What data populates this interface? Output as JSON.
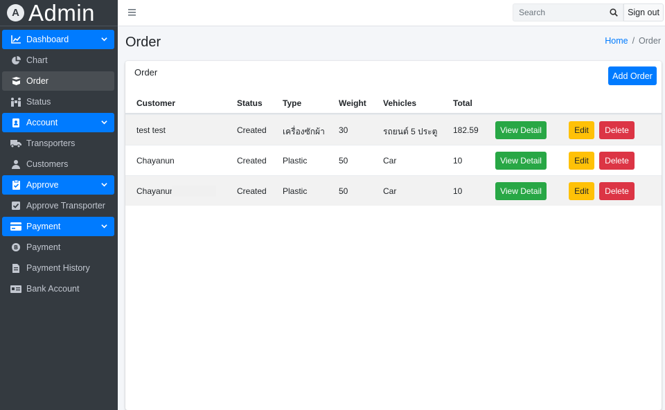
{
  "brand": {
    "logo_letter": "A",
    "title": "Admin"
  },
  "sidebar": {
    "items": [
      {
        "label": "Dashboard",
        "icon": "chart-area-icon",
        "type": "header"
      },
      {
        "label": "Chart",
        "icon": "pie-chart-icon",
        "type": "item"
      },
      {
        "label": "Order",
        "icon": "box-open-icon",
        "type": "active"
      },
      {
        "label": "Status",
        "icon": "people-carry-icon",
        "type": "item"
      },
      {
        "label": "Account",
        "icon": "address-book-icon",
        "type": "header"
      },
      {
        "label": "Transporters",
        "icon": "truck-icon",
        "type": "item"
      },
      {
        "label": "Customers",
        "icon": "user-tie-icon",
        "type": "item"
      },
      {
        "label": "Approve",
        "icon": "clipboard-check-icon",
        "type": "header"
      },
      {
        "label": "Approve Transporter",
        "icon": "check-square-icon",
        "type": "item"
      },
      {
        "label": "Payment",
        "icon": "credit-card-icon",
        "type": "header"
      },
      {
        "label": "Payment",
        "icon": "bitcoin-icon",
        "type": "item"
      },
      {
        "label": "Payment History",
        "icon": "file-invoice-icon",
        "type": "item"
      },
      {
        "label": "Bank Account",
        "icon": "money-check-icon",
        "type": "item"
      }
    ]
  },
  "topbar": {
    "search_placeholder": "Search",
    "signout_label": "Sign out"
  },
  "page": {
    "title": "Order",
    "breadcrumb_home": "Home",
    "breadcrumb_sep": "/",
    "breadcrumb_current": "Order"
  },
  "card": {
    "title": "Order",
    "add_button": "Add Order"
  },
  "table": {
    "headers": {
      "customer": "Customer",
      "status": "Status",
      "type": "Type",
      "weight": "Weight",
      "vehicles": "Vehicles",
      "total": "Total"
    },
    "rows": [
      {
        "customer": "test test",
        "status": "Created",
        "type": "เครื่องซักผ้า",
        "weight": "30",
        "vehicles": "รถยนต์ 5 ประตู",
        "total": "182.59"
      },
      {
        "customer": "Chayanun",
        "status": "Created",
        "type": "Plastic",
        "weight": "50",
        "vehicles": "Car",
        "total": "10"
      },
      {
        "customer": "Chayanun",
        "status": "Created",
        "type": "Plastic",
        "weight": "50",
        "vehicles": "Car",
        "total": "10"
      }
    ],
    "actions": {
      "view": "View Detail",
      "edit": "Edit",
      "delete": "Delete"
    }
  },
  "colors": {
    "primary": "#007bff",
    "success": "#28a745",
    "warning": "#ffc107",
    "danger": "#dc3545",
    "sidebar": "#343a40"
  }
}
